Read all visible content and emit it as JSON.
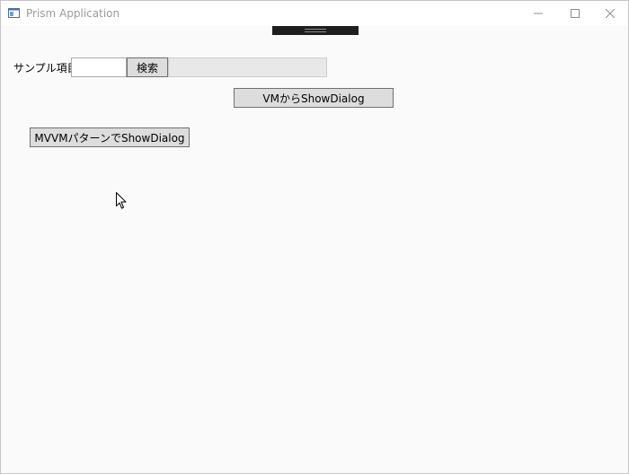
{
  "window": {
    "title": "Prism Application",
    "controls": {
      "minimize_icon": "minimize-icon",
      "maximize_icon": "maximize-icon",
      "close_icon": "close-icon"
    }
  },
  "form": {
    "sample_label": "サンプル項目",
    "search_value": "",
    "search_button": "検索",
    "result_value": ""
  },
  "actions": {
    "vm_show_dialog": "VMからShowDialog",
    "mvvm_show_dialog": "MVVMパターンでShowDialog"
  },
  "colors": {
    "button_bg": "#dddddd",
    "button_border": "#707070",
    "result_bg": "#e8e8e8",
    "devbar_bg": "#1e1e1e",
    "window_bg": "#fafafa"
  }
}
